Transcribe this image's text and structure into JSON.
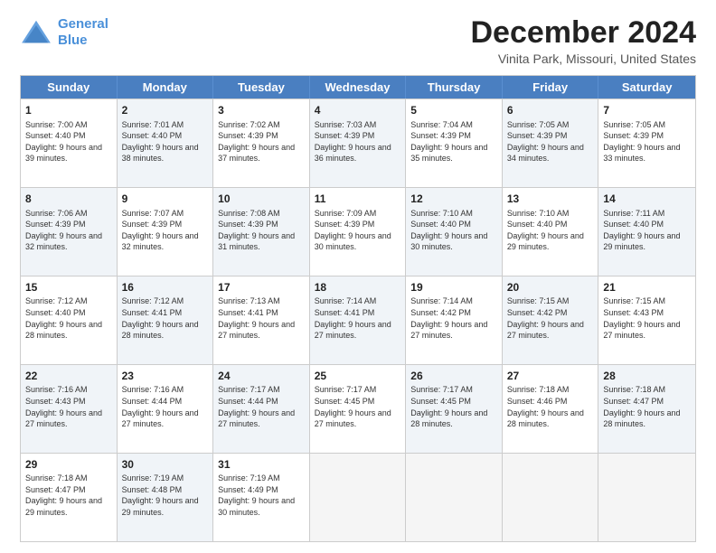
{
  "logo": {
    "line1": "General",
    "line2": "Blue"
  },
  "title": "December 2024",
  "location": "Vinita Park, Missouri, United States",
  "days_of_week": [
    "Sunday",
    "Monday",
    "Tuesday",
    "Wednesday",
    "Thursday",
    "Friday",
    "Saturday"
  ],
  "weeks": [
    [
      {
        "day": "1",
        "rise": "Sunrise: 7:00 AM",
        "set": "Sunset: 4:40 PM",
        "light": "Daylight: 9 hours and 39 minutes.",
        "shade": false
      },
      {
        "day": "2",
        "rise": "Sunrise: 7:01 AM",
        "set": "Sunset: 4:40 PM",
        "light": "Daylight: 9 hours and 38 minutes.",
        "shade": true
      },
      {
        "day": "3",
        "rise": "Sunrise: 7:02 AM",
        "set": "Sunset: 4:39 PM",
        "light": "Daylight: 9 hours and 37 minutes.",
        "shade": false
      },
      {
        "day": "4",
        "rise": "Sunrise: 7:03 AM",
        "set": "Sunset: 4:39 PM",
        "light": "Daylight: 9 hours and 36 minutes.",
        "shade": true
      },
      {
        "day": "5",
        "rise": "Sunrise: 7:04 AM",
        "set": "Sunset: 4:39 PM",
        "light": "Daylight: 9 hours and 35 minutes.",
        "shade": false
      },
      {
        "day": "6",
        "rise": "Sunrise: 7:05 AM",
        "set": "Sunset: 4:39 PM",
        "light": "Daylight: 9 hours and 34 minutes.",
        "shade": true
      },
      {
        "day": "7",
        "rise": "Sunrise: 7:05 AM",
        "set": "Sunset: 4:39 PM",
        "light": "Daylight: 9 hours and 33 minutes.",
        "shade": false
      }
    ],
    [
      {
        "day": "8",
        "rise": "Sunrise: 7:06 AM",
        "set": "Sunset: 4:39 PM",
        "light": "Daylight: 9 hours and 32 minutes.",
        "shade": true
      },
      {
        "day": "9",
        "rise": "Sunrise: 7:07 AM",
        "set": "Sunset: 4:39 PM",
        "light": "Daylight: 9 hours and 32 minutes.",
        "shade": false
      },
      {
        "day": "10",
        "rise": "Sunrise: 7:08 AM",
        "set": "Sunset: 4:39 PM",
        "light": "Daylight: 9 hours and 31 minutes.",
        "shade": true
      },
      {
        "day": "11",
        "rise": "Sunrise: 7:09 AM",
        "set": "Sunset: 4:39 PM",
        "light": "Daylight: 9 hours and 30 minutes.",
        "shade": false
      },
      {
        "day": "12",
        "rise": "Sunrise: 7:10 AM",
        "set": "Sunset: 4:40 PM",
        "light": "Daylight: 9 hours and 30 minutes.",
        "shade": true
      },
      {
        "day": "13",
        "rise": "Sunrise: 7:10 AM",
        "set": "Sunset: 4:40 PM",
        "light": "Daylight: 9 hours and 29 minutes.",
        "shade": false
      },
      {
        "day": "14",
        "rise": "Sunrise: 7:11 AM",
        "set": "Sunset: 4:40 PM",
        "light": "Daylight: 9 hours and 29 minutes.",
        "shade": true
      }
    ],
    [
      {
        "day": "15",
        "rise": "Sunrise: 7:12 AM",
        "set": "Sunset: 4:40 PM",
        "light": "Daylight: 9 hours and 28 minutes.",
        "shade": false
      },
      {
        "day": "16",
        "rise": "Sunrise: 7:12 AM",
        "set": "Sunset: 4:41 PM",
        "light": "Daylight: 9 hours and 28 minutes.",
        "shade": true
      },
      {
        "day": "17",
        "rise": "Sunrise: 7:13 AM",
        "set": "Sunset: 4:41 PM",
        "light": "Daylight: 9 hours and 27 minutes.",
        "shade": false
      },
      {
        "day": "18",
        "rise": "Sunrise: 7:14 AM",
        "set": "Sunset: 4:41 PM",
        "light": "Daylight: 9 hours and 27 minutes.",
        "shade": true
      },
      {
        "day": "19",
        "rise": "Sunrise: 7:14 AM",
        "set": "Sunset: 4:42 PM",
        "light": "Daylight: 9 hours and 27 minutes.",
        "shade": false
      },
      {
        "day": "20",
        "rise": "Sunrise: 7:15 AM",
        "set": "Sunset: 4:42 PM",
        "light": "Daylight: 9 hours and 27 minutes.",
        "shade": true
      },
      {
        "day": "21",
        "rise": "Sunrise: 7:15 AM",
        "set": "Sunset: 4:43 PM",
        "light": "Daylight: 9 hours and 27 minutes.",
        "shade": false
      }
    ],
    [
      {
        "day": "22",
        "rise": "Sunrise: 7:16 AM",
        "set": "Sunset: 4:43 PM",
        "light": "Daylight: 9 hours and 27 minutes.",
        "shade": true
      },
      {
        "day": "23",
        "rise": "Sunrise: 7:16 AM",
        "set": "Sunset: 4:44 PM",
        "light": "Daylight: 9 hours and 27 minutes.",
        "shade": false
      },
      {
        "day": "24",
        "rise": "Sunrise: 7:17 AM",
        "set": "Sunset: 4:44 PM",
        "light": "Daylight: 9 hours and 27 minutes.",
        "shade": true
      },
      {
        "day": "25",
        "rise": "Sunrise: 7:17 AM",
        "set": "Sunset: 4:45 PM",
        "light": "Daylight: 9 hours and 27 minutes.",
        "shade": false
      },
      {
        "day": "26",
        "rise": "Sunrise: 7:17 AM",
        "set": "Sunset: 4:45 PM",
        "light": "Daylight: 9 hours and 28 minutes.",
        "shade": true
      },
      {
        "day": "27",
        "rise": "Sunrise: 7:18 AM",
        "set": "Sunset: 4:46 PM",
        "light": "Daylight: 9 hours and 28 minutes.",
        "shade": false
      },
      {
        "day": "28",
        "rise": "Sunrise: 7:18 AM",
        "set": "Sunset: 4:47 PM",
        "light": "Daylight: 9 hours and 28 minutes.",
        "shade": true
      }
    ],
    [
      {
        "day": "29",
        "rise": "Sunrise: 7:18 AM",
        "set": "Sunset: 4:47 PM",
        "light": "Daylight: 9 hours and 29 minutes.",
        "shade": false
      },
      {
        "day": "30",
        "rise": "Sunrise: 7:19 AM",
        "set": "Sunset: 4:48 PM",
        "light": "Daylight: 9 hours and 29 minutes.",
        "shade": true
      },
      {
        "day": "31",
        "rise": "Sunrise: 7:19 AM",
        "set": "Sunset: 4:49 PM",
        "light": "Daylight: 9 hours and 30 minutes.",
        "shade": false
      },
      {
        "day": "",
        "rise": "",
        "set": "",
        "light": "",
        "shade": false,
        "empty": true
      },
      {
        "day": "",
        "rise": "",
        "set": "",
        "light": "",
        "shade": false,
        "empty": true
      },
      {
        "day": "",
        "rise": "",
        "set": "",
        "light": "",
        "shade": false,
        "empty": true
      },
      {
        "day": "",
        "rise": "",
        "set": "",
        "light": "",
        "shade": false,
        "empty": true
      }
    ]
  ]
}
